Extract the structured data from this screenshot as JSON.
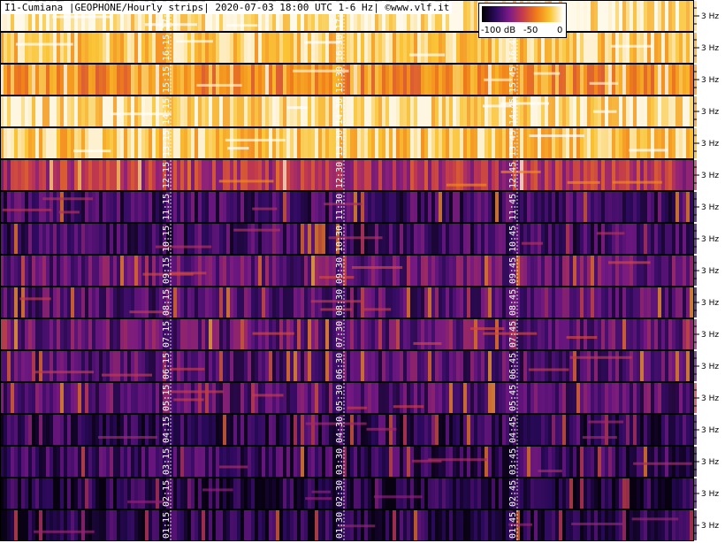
{
  "header": {
    "title": "I1-Cumiana |GEOPHONE/Hourly strips| 2020-07-03 18:00 UTC 1-6 Hz| ©www.vlf.it"
  },
  "color_scale": {
    "min_label": "-100 dB",
    "mid_label": "-50",
    "max_label": "0"
  },
  "chart_data": {
    "type": "heatmap",
    "title": "I1-Cumiana |GEOPHONE/Hourly strips| 2020-07-03 18:00 UTC 1-6 Hz| ©www.vlf.it",
    "right_tick_label": "3 Hz",
    "color_range_db": [
      -100,
      0
    ],
    "colormap_stops": [
      "#000000",
      "#2b0a5e",
      "#7a1a87",
      "#c63b4a",
      "#f07a18",
      "#f9c22e",
      "#ffffff"
    ],
    "strips": [
      {
        "hour": "17",
        "markers": [
          "17:15",
          "17:30",
          "17:45"
        ],
        "level": 0.93
      },
      {
        "hour": "16",
        "markers": [
          "16:15",
          "16:30",
          "16:45"
        ],
        "level": 0.86
      },
      {
        "hour": "15",
        "markers": [
          "15:15",
          "15:30",
          "15:45"
        ],
        "level": 0.72
      },
      {
        "hour": "14",
        "markers": [
          "14:15",
          "14:30",
          "14:45"
        ],
        "level": 0.9
      },
      {
        "hour": "13",
        "markers": [
          "13:15",
          "13:30",
          "13:45"
        ],
        "level": 0.85
      },
      {
        "hour": "12",
        "markers": [
          "12:15",
          "12:30",
          "12:45"
        ],
        "level": 0.45
      },
      {
        "hour": "11",
        "markers": [
          "11:15",
          "11:30",
          "11:45"
        ],
        "level": 0.2
      },
      {
        "hour": "10",
        "markers": [
          "10:15",
          "10:30",
          "10:45"
        ],
        "level": 0.2
      },
      {
        "hour": "09",
        "markers": [
          "09:15",
          "09:30",
          "09:45"
        ],
        "level": 0.28
      },
      {
        "hour": "08",
        "markers": [
          "08:15",
          "08:30",
          "08:45"
        ],
        "level": 0.24
      },
      {
        "hour": "07",
        "markers": [
          "07:15",
          "07:30",
          "07:45"
        ],
        "level": 0.28
      },
      {
        "hour": "06",
        "markers": [
          "06:15",
          "06:30",
          "06:45"
        ],
        "level": 0.24
      },
      {
        "hour": "05",
        "markers": [
          "05:15",
          "05:30",
          "05:45"
        ],
        "level": 0.25
      },
      {
        "hour": "04",
        "markers": [
          "04:15",
          "04:30",
          "04:45"
        ],
        "level": 0.16
      },
      {
        "hour": "03",
        "markers": [
          "03:15",
          "03:30",
          "03:45"
        ],
        "level": 0.18
      },
      {
        "hour": "02",
        "markers": [
          "02:15",
          "02:30",
          "02:45"
        ],
        "level": 0.12
      },
      {
        "hour": "01",
        "markers": [
          "01:15",
          "01:30",
          "01:45"
        ],
        "level": 0.14
      }
    ]
  }
}
